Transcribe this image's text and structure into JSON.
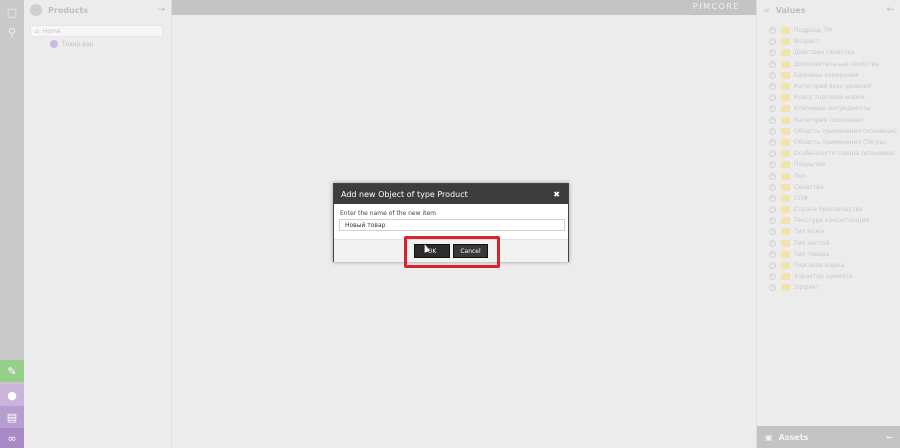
{
  "rail": {
    "top_icons": [
      "file-icon",
      "search-icon"
    ],
    "bottom_icons": [
      "notification-icon",
      "user-icon",
      "tasks-icon",
      "logo-icon"
    ],
    "colors": {
      "green": "#95cf8a",
      "purple1": "#c9b5dc",
      "purple2": "#b69ed0",
      "purple3": "#a98ac7"
    }
  },
  "products": {
    "title": "Products",
    "tree": [
      {
        "label": "Home"
      },
      {
        "label": "Товар вар"
      }
    ]
  },
  "topbar": {
    "logo": "PIMCORE"
  },
  "values": {
    "title": "Values",
    "items": [
      "Подразд ТМ",
      "Возраст",
      "Действие свойства",
      "Дополнительные свойства",
      "Единицы измерения",
      "Категория всех уровней",
      "Класс торговой марки",
      "Ключевые ингредиенты",
      "Категория (основная)",
      "Область применения (основная)",
      "Область применения (Тегры)",
      "Особенности товара (упаковки)",
      "Покрытие",
      "Пол",
      "Свойства",
      "СПФ",
      "Страна производства",
      "Текстура консистенции",
      "Тип кожи",
      "Тип ногтей",
      "Тип товара",
      "Торговая марка",
      "Характер аромата",
      "Эффект"
    ],
    "assets_label": "Assets"
  },
  "dialog": {
    "title": "Add new Object of type Product",
    "label": "Enter the name of the new item",
    "input_value": "Новый товар",
    "ok_label": "OK",
    "cancel_label": "Cancel",
    "highlight_color": "#d8232a"
  }
}
